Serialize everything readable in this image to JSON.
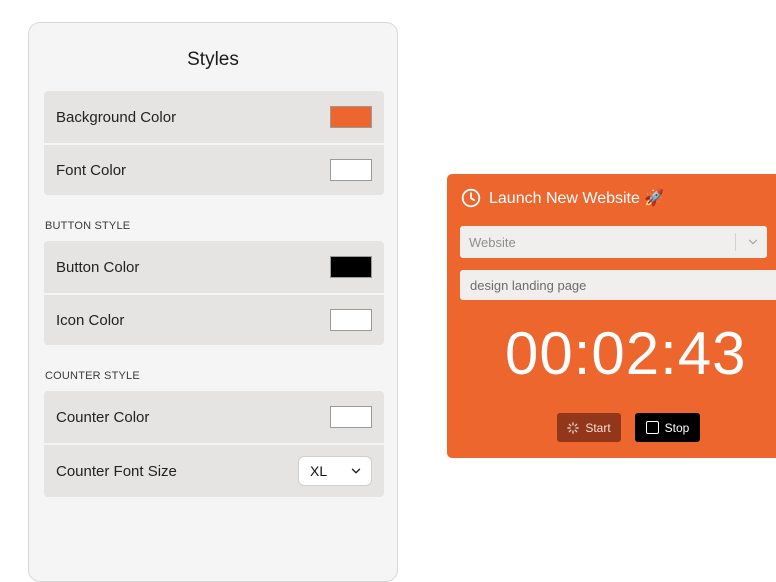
{
  "styles_panel": {
    "title": "Styles",
    "general": [
      {
        "label": "Background Color",
        "color": "#ec662d"
      },
      {
        "label": "Font Color",
        "color": "#ffffff"
      }
    ],
    "button_style": {
      "label": "BUTTON STYLE",
      "items": [
        {
          "label": "Button Color",
          "color": "#000000"
        },
        {
          "label": "Icon Color",
          "color": "#ffffff"
        }
      ]
    },
    "counter_style": {
      "label": "COUNTER STYLE",
      "counter_color": {
        "label": "Counter Color",
        "color": "#ffffff"
      },
      "font_size": {
        "label": "Counter Font Size",
        "value": "XL"
      }
    }
  },
  "timer_widget": {
    "title": "Launch New Website 🚀",
    "project_select": "Website",
    "task_placeholder": "design landing page",
    "counter": "00:02:43",
    "start_label": "Start",
    "stop_label": "Stop",
    "icons": {
      "title": "clock-icon",
      "start": "spinner-icon",
      "stop": "stop-square-icon"
    }
  }
}
